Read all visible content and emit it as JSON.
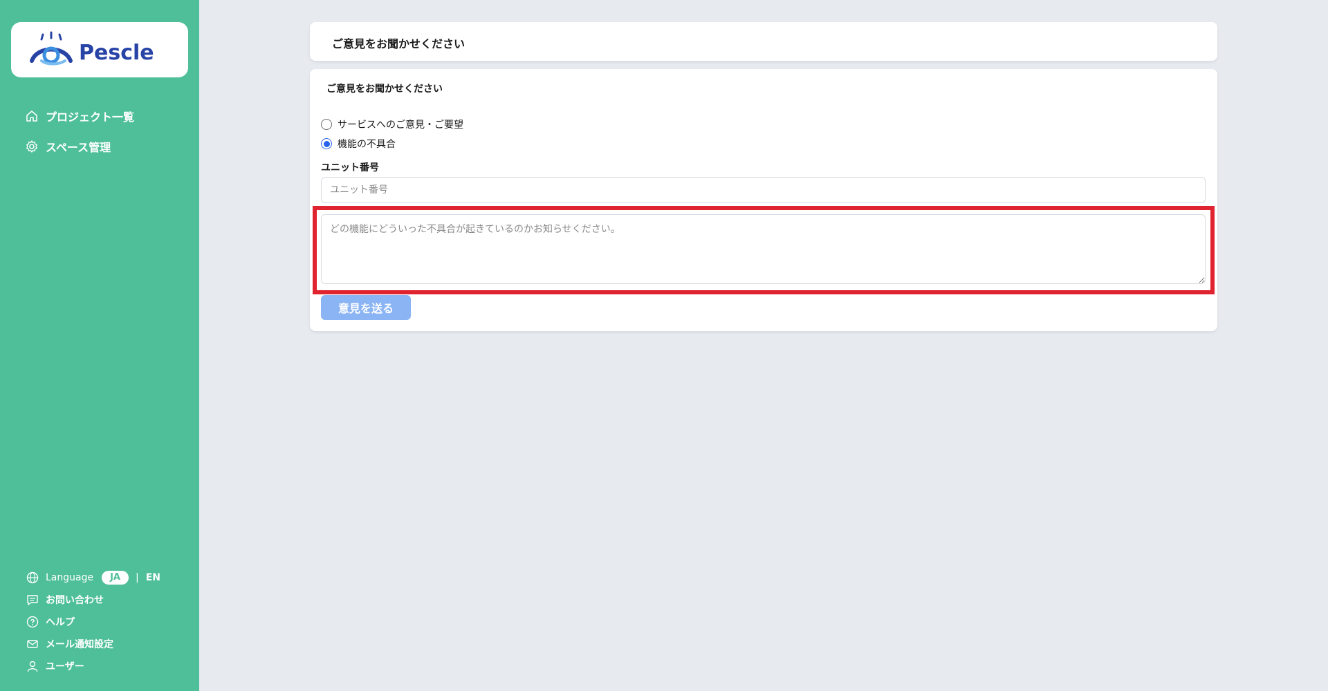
{
  "app": {
    "logo_text": "Pescle"
  },
  "sidebar": {
    "nav": [
      {
        "label": "プロジェクト一覧",
        "icon": "home-icon"
      },
      {
        "label": "スペース管理",
        "icon": "gear-icon"
      }
    ],
    "language": {
      "label": "Language",
      "active": "JA",
      "separator": "|",
      "other": "EN"
    },
    "bottom": [
      {
        "label": "お問い合わせ",
        "icon": "chat-icon"
      },
      {
        "label": "ヘルプ",
        "icon": "help-icon"
      },
      {
        "label": "メール通知設定",
        "icon": "mail-icon"
      },
      {
        "label": "ユーザー",
        "icon": "user-icon"
      }
    ]
  },
  "header": {
    "title": "ご意見をお聞かせください"
  },
  "form": {
    "title": "ご意見をお聞かせください",
    "options": [
      {
        "label": "サービスへのご意見・ご要望",
        "checked": false
      },
      {
        "label": "機能の不具合",
        "checked": true
      }
    ],
    "unit_label": "ユニット番号",
    "unit_placeholder": "ユニット番号",
    "unit_value": "",
    "detail_placeholder": "どの機能にどういった不具合が起きているのかお知らせください。",
    "detail_value": "",
    "submit_label": "意見を送る"
  },
  "colors": {
    "sidebar_bg": "#4ebf99",
    "page_bg": "#e7eaef",
    "accent_blue": "#2563eb",
    "button_bg": "#8ab4f3",
    "highlight_red": "#e0242f"
  }
}
